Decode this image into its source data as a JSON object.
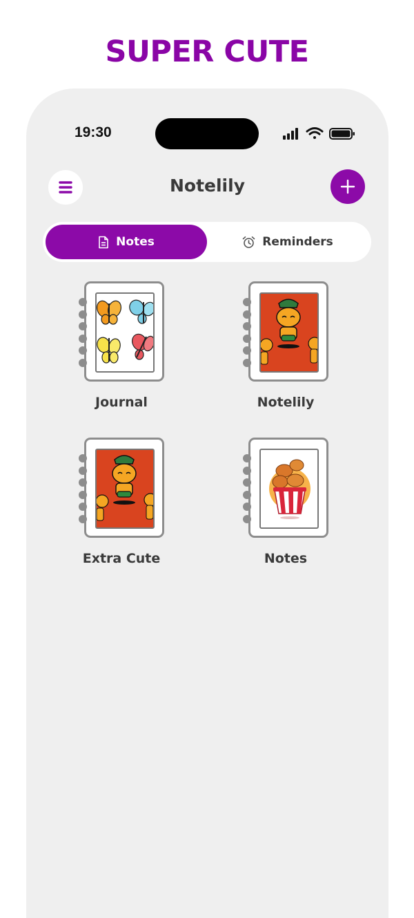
{
  "promo": {
    "headline": "SUPER CUTE"
  },
  "status_bar": {
    "time": "19:30"
  },
  "header": {
    "title": "Notelily",
    "menu_icon": "hamburger-menu-icon",
    "add_icon": "plus-icon"
  },
  "tabs": [
    {
      "label": "Notes",
      "icon": "document-icon",
      "selected": true
    },
    {
      "label": "Reminders",
      "icon": "alarm-clock-icon",
      "selected": false
    }
  ],
  "notebooks": [
    {
      "title": "Journal",
      "cover": "butterflies"
    },
    {
      "title": "Notelily",
      "cover": "cartoon-dog"
    },
    {
      "title": "Extra Cute",
      "cover": "cartoon-dog"
    },
    {
      "title": "Notes",
      "cover": "fried-chicken-bucket"
    }
  ],
  "colors": {
    "accent": "#8c0aa8",
    "headline": "#8a05a6",
    "background": "#efefef",
    "text": "#3a3a3a"
  }
}
